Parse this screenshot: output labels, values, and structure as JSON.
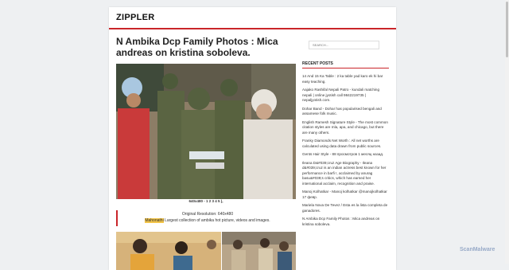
{
  "header": {
    "logo": "ZIPPLER"
  },
  "article": {
    "title": "N Ambika Dcp Family Photos : Mica andreas on kristina soboleva.",
    "caption": "640x480 - 1 2 3 4 5 ),",
    "resolution": "Original Resolution: 640x480",
    "highlight": "Mahonathi",
    "desc": " Largest collection of ambika hot picture, videos and images."
  },
  "sidebar": {
    "search_placeholder": "SEARCH...",
    "recent_heading": "RECENT POSTS",
    "posts": [
      "14 And 15 Ka Table : 2 ka table yad karo ek hi bar easy teaching.",
      "Aajako Rashifal Nepali Patro - kundali matching nepali | online jyotish call 9842219735 | nepaljyotish.com.",
      "Dohar Band - Dohar has popularised bengali and assamese folk music.",
      "English Ramesh Signature Style - The most common citation styles are mla, apa, and chicago, but there are many others.",
      "Franky Diamonds Net Worth : All net worths are calculated using data drawn from public sources.",
      "Gents Hair Style - 88 просмотров 1 месяц назад.",
      "Ileana D&#039;cruz Age Biography - Ileana d&#039;cruz is an indian actress best known for her performance in barfi !, acclaimed by anurag basu&#039;s critics, which has earned her international acclaim, recognition and praise.",
      "Manoj Kolhatkar - Manoj kolhatkar @manojkolhatkar 17 февр.",
      "Mariela Nova De Tevez / Esta es la lista completa de ganadores.",
      "N Ambika Dcp Family Photos : Mica andreas on kristina soboleva."
    ]
  },
  "watermark": "ScanMalware"
}
